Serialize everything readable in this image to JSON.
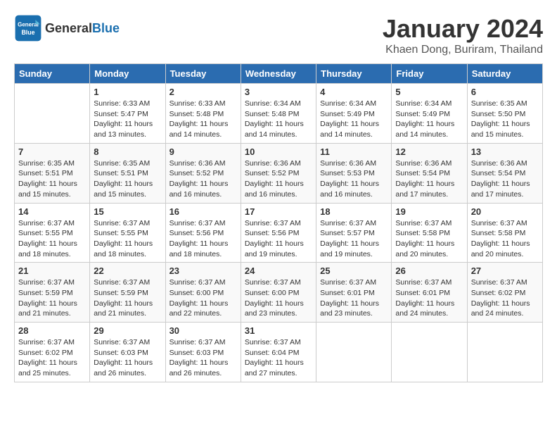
{
  "header": {
    "logo_general": "General",
    "logo_blue": "Blue",
    "month_title": "January 2024",
    "location": "Khaen Dong, Buriram, Thailand"
  },
  "days_of_week": [
    "Sunday",
    "Monday",
    "Tuesday",
    "Wednesday",
    "Thursday",
    "Friday",
    "Saturday"
  ],
  "weeks": [
    [
      {
        "day": "",
        "info": ""
      },
      {
        "day": "1",
        "info": "Sunrise: 6:33 AM\nSunset: 5:47 PM\nDaylight: 11 hours\nand 13 minutes."
      },
      {
        "day": "2",
        "info": "Sunrise: 6:33 AM\nSunset: 5:48 PM\nDaylight: 11 hours\nand 14 minutes."
      },
      {
        "day": "3",
        "info": "Sunrise: 6:34 AM\nSunset: 5:48 PM\nDaylight: 11 hours\nand 14 minutes."
      },
      {
        "day": "4",
        "info": "Sunrise: 6:34 AM\nSunset: 5:49 PM\nDaylight: 11 hours\nand 14 minutes."
      },
      {
        "day": "5",
        "info": "Sunrise: 6:34 AM\nSunset: 5:49 PM\nDaylight: 11 hours\nand 14 minutes."
      },
      {
        "day": "6",
        "info": "Sunrise: 6:35 AM\nSunset: 5:50 PM\nDaylight: 11 hours\nand 15 minutes."
      }
    ],
    [
      {
        "day": "7",
        "info": "Sunrise: 6:35 AM\nSunset: 5:51 PM\nDaylight: 11 hours\nand 15 minutes."
      },
      {
        "day": "8",
        "info": "Sunrise: 6:35 AM\nSunset: 5:51 PM\nDaylight: 11 hours\nand 15 minutes."
      },
      {
        "day": "9",
        "info": "Sunrise: 6:36 AM\nSunset: 5:52 PM\nDaylight: 11 hours\nand 16 minutes."
      },
      {
        "day": "10",
        "info": "Sunrise: 6:36 AM\nSunset: 5:52 PM\nDaylight: 11 hours\nand 16 minutes."
      },
      {
        "day": "11",
        "info": "Sunrise: 6:36 AM\nSunset: 5:53 PM\nDaylight: 11 hours\nand 16 minutes."
      },
      {
        "day": "12",
        "info": "Sunrise: 6:36 AM\nSunset: 5:54 PM\nDaylight: 11 hours\nand 17 minutes."
      },
      {
        "day": "13",
        "info": "Sunrise: 6:36 AM\nSunset: 5:54 PM\nDaylight: 11 hours\nand 17 minutes."
      }
    ],
    [
      {
        "day": "14",
        "info": "Sunrise: 6:37 AM\nSunset: 5:55 PM\nDaylight: 11 hours\nand 18 minutes."
      },
      {
        "day": "15",
        "info": "Sunrise: 6:37 AM\nSunset: 5:55 PM\nDaylight: 11 hours\nand 18 minutes."
      },
      {
        "day": "16",
        "info": "Sunrise: 6:37 AM\nSunset: 5:56 PM\nDaylight: 11 hours\nand 18 minutes."
      },
      {
        "day": "17",
        "info": "Sunrise: 6:37 AM\nSunset: 5:56 PM\nDaylight: 11 hours\nand 19 minutes."
      },
      {
        "day": "18",
        "info": "Sunrise: 6:37 AM\nSunset: 5:57 PM\nDaylight: 11 hours\nand 19 minutes."
      },
      {
        "day": "19",
        "info": "Sunrise: 6:37 AM\nSunset: 5:58 PM\nDaylight: 11 hours\nand 20 minutes."
      },
      {
        "day": "20",
        "info": "Sunrise: 6:37 AM\nSunset: 5:58 PM\nDaylight: 11 hours\nand 20 minutes."
      }
    ],
    [
      {
        "day": "21",
        "info": "Sunrise: 6:37 AM\nSunset: 5:59 PM\nDaylight: 11 hours\nand 21 minutes."
      },
      {
        "day": "22",
        "info": "Sunrise: 6:37 AM\nSunset: 5:59 PM\nDaylight: 11 hours\nand 21 minutes."
      },
      {
        "day": "23",
        "info": "Sunrise: 6:37 AM\nSunset: 6:00 PM\nDaylight: 11 hours\nand 22 minutes."
      },
      {
        "day": "24",
        "info": "Sunrise: 6:37 AM\nSunset: 6:00 PM\nDaylight: 11 hours\nand 23 minutes."
      },
      {
        "day": "25",
        "info": "Sunrise: 6:37 AM\nSunset: 6:01 PM\nDaylight: 11 hours\nand 23 minutes."
      },
      {
        "day": "26",
        "info": "Sunrise: 6:37 AM\nSunset: 6:01 PM\nDaylight: 11 hours\nand 24 minutes."
      },
      {
        "day": "27",
        "info": "Sunrise: 6:37 AM\nSunset: 6:02 PM\nDaylight: 11 hours\nand 24 minutes."
      }
    ],
    [
      {
        "day": "28",
        "info": "Sunrise: 6:37 AM\nSunset: 6:02 PM\nDaylight: 11 hours\nand 25 minutes."
      },
      {
        "day": "29",
        "info": "Sunrise: 6:37 AM\nSunset: 6:03 PM\nDaylight: 11 hours\nand 26 minutes."
      },
      {
        "day": "30",
        "info": "Sunrise: 6:37 AM\nSunset: 6:03 PM\nDaylight: 11 hours\nand 26 minutes."
      },
      {
        "day": "31",
        "info": "Sunrise: 6:37 AM\nSunset: 6:04 PM\nDaylight: 11 hours\nand 27 minutes."
      },
      {
        "day": "",
        "info": ""
      },
      {
        "day": "",
        "info": ""
      },
      {
        "day": "",
        "info": ""
      }
    ]
  ]
}
